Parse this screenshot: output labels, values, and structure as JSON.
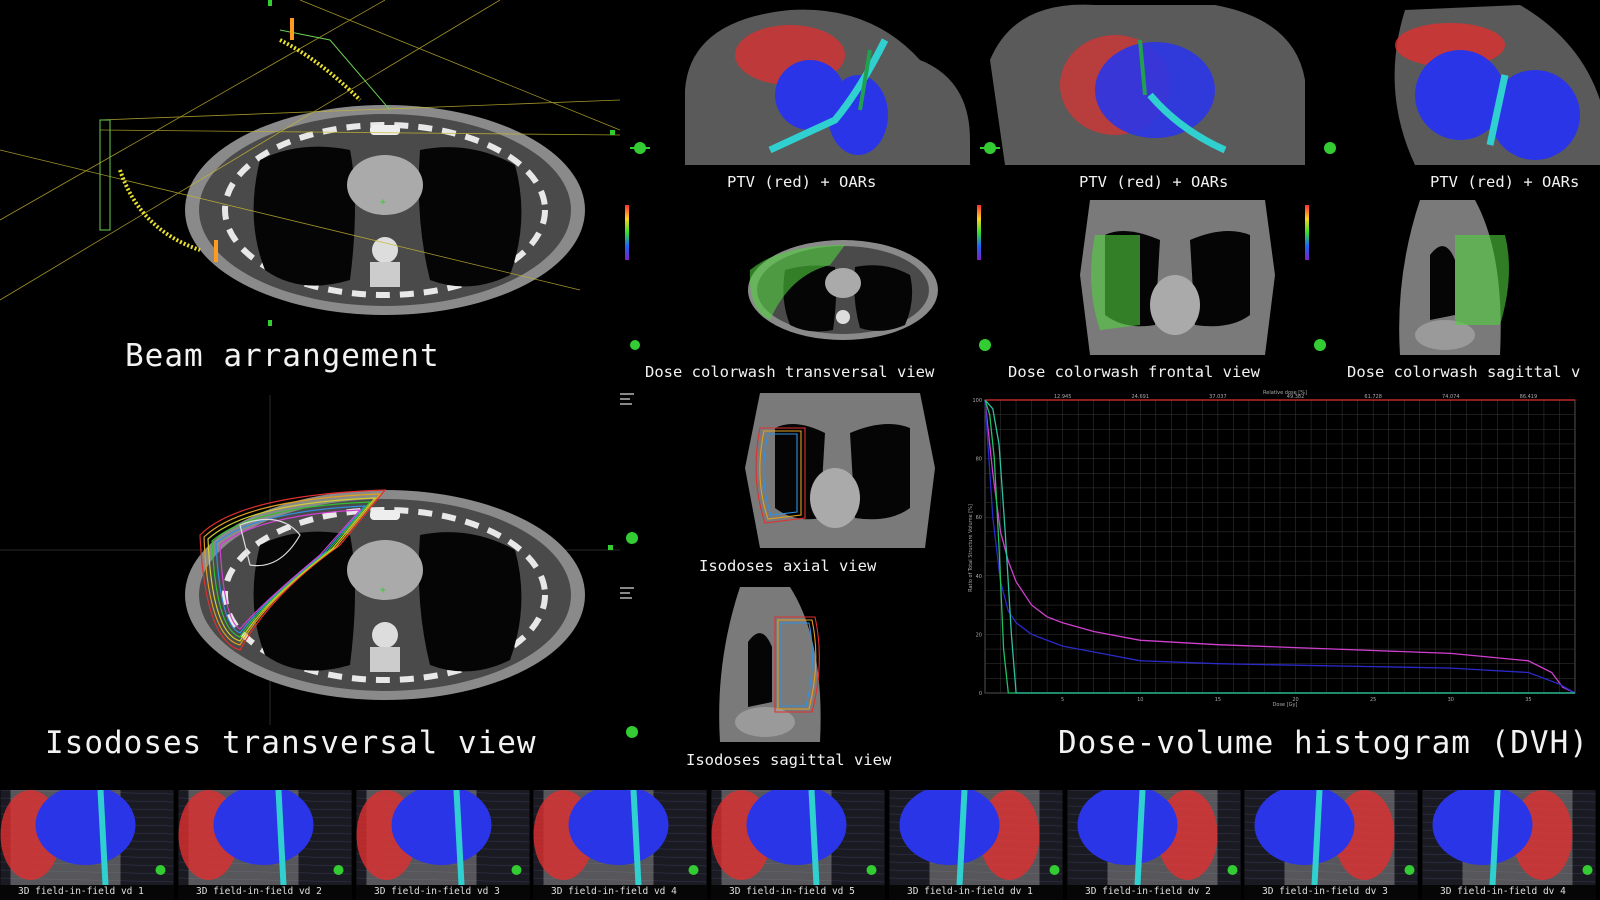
{
  "colors": {
    "ptv": "#e03030",
    "oar_lung": "#2b35e8",
    "trachea": "#30d0d0",
    "background": "#000000",
    "dvh_grid": "#3a3a3a",
    "dvh_magenta": "#d040d0",
    "dvh_blue": "#2a2ac8",
    "dvh_green": "#20c060",
    "dvh_red": "#e03030"
  },
  "captions": {
    "beam_arrangement": "Beam arrangement",
    "isodoses_transversal": "Isodoses transversal view",
    "dvh": "Dose-volume histogram (DVH)",
    "ptv_oars_1": "PTV (red) + OARs",
    "ptv_oars_2": "PTV (red) + OARs",
    "ptv_oars_3": "PTV (red) + OARs",
    "colorwash_transversal": "Dose colorwash transversal view",
    "colorwash_frontal": "Dose colorwash frontal view",
    "colorwash_sagittal": "Dose colorwash sagittal v",
    "isodoses_axial": "Isodoses axial view",
    "isodoses_sagittal": "Isodoses sagittal view"
  },
  "thumbnails": [
    {
      "label": "3D field-in-field vd 1"
    },
    {
      "label": "3D field-in-field vd 2"
    },
    {
      "label": "3D field-in-field vd 3"
    },
    {
      "label": "3D field-in-field vd 4"
    },
    {
      "label": "3D field-in-field vd 5"
    },
    {
      "label": "3D field-in-field dv 1"
    },
    {
      "label": "3D field-in-field dv 2"
    },
    {
      "label": "3D field-in-field dv 3"
    },
    {
      "label": "3D field-in-field dv 4"
    }
  ],
  "chart_data": {
    "type": "line",
    "title": "",
    "top_axis_label": "Relative dose [%]",
    "xlabel": "Dose [Gy]",
    "ylabel": "Ratio of Total Structure Volume [%]",
    "xlim": [
      0,
      38
    ],
    "ylim": [
      0,
      100
    ],
    "x_ticks": [
      5,
      10,
      15,
      20,
      25,
      30,
      35
    ],
    "y_ticks": [
      0,
      20,
      40,
      60,
      80,
      100
    ],
    "top_ticks": [
      "12.945",
      "24.691",
      "37.037",
      "49.382",
      "61.728",
      "74.074",
      "86.419"
    ],
    "grid": true,
    "series": [
      {
        "color": "#d040d0",
        "x": [
          0,
          0.5,
          1,
          1.5,
          2,
          3,
          4,
          5,
          7,
          10,
          15,
          20,
          25,
          30,
          35,
          36.5,
          37.2,
          38
        ],
        "y": [
          100,
          75,
          55,
          45,
          38,
          30,
          26,
          24,
          21,
          18,
          16.5,
          15.5,
          14.5,
          13.5,
          11,
          7,
          2,
          0
        ]
      },
      {
        "color": "#2a2ac8",
        "x": [
          0,
          0.5,
          1,
          1.5,
          2,
          3,
          5,
          8,
          10,
          15,
          20,
          25,
          30,
          35,
          37,
          38
        ],
        "y": [
          100,
          60,
          38,
          28,
          24,
          20,
          16,
          13,
          11,
          10,
          9.5,
          9,
          8.5,
          7,
          3,
          0
        ]
      },
      {
        "color": "#20c060",
        "x": [
          0,
          0.3,
          0.6,
          0.9,
          1.2,
          1.5,
          38
        ],
        "y": [
          100,
          95,
          80,
          50,
          15,
          0,
          0
        ]
      },
      {
        "color": "#30c0a0",
        "x": [
          0,
          0.5,
          0.9,
          1.3,
          1.7,
          2.0,
          38
        ],
        "y": [
          100,
          97,
          85,
          55,
          20,
          0,
          0
        ]
      },
      {
        "color": "#e03030",
        "x": [
          0,
          36,
          37,
          38
        ],
        "y": [
          100,
          100,
          100,
          100
        ]
      }
    ]
  }
}
